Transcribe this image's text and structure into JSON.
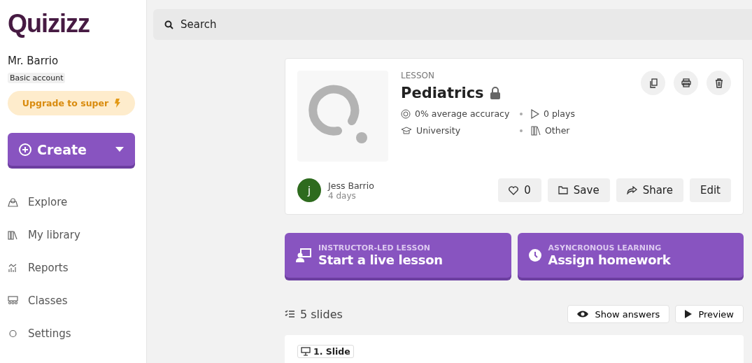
{
  "logo": "Quizizz",
  "user": {
    "name": "Mr. Barrio",
    "plan": "Basic account",
    "upgrade": "Upgrade to super"
  },
  "create": {
    "label": "Create"
  },
  "nav": [
    {
      "label": "Explore"
    },
    {
      "label": "My library"
    },
    {
      "label": "Reports"
    },
    {
      "label": "Classes"
    },
    {
      "label": "Settings"
    }
  ],
  "search": {
    "placeholder": "Search"
  },
  "lesson": {
    "type": "LESSON",
    "title": "Pediatrics",
    "locked": true,
    "accuracy": "0% average accuracy",
    "plays": "0 plays",
    "grade": "University",
    "subject": "Other",
    "author": "Jess Barrio",
    "author_initial": "j",
    "age": "4 days",
    "likes": "0",
    "buttons": [
      "Save",
      "Share",
      "Edit"
    ]
  },
  "actions": [
    {
      "kicker": "INSTRUCTOR-LED LESSON",
      "label": "Start a live lesson"
    },
    {
      "kicker": "ASYNCRONOUS LEARNING",
      "label": "Assign homework"
    }
  ],
  "slides": {
    "count": "5 slides",
    "show_answers": "Show answers",
    "preview": "Preview",
    "first": "1. Slide"
  }
}
